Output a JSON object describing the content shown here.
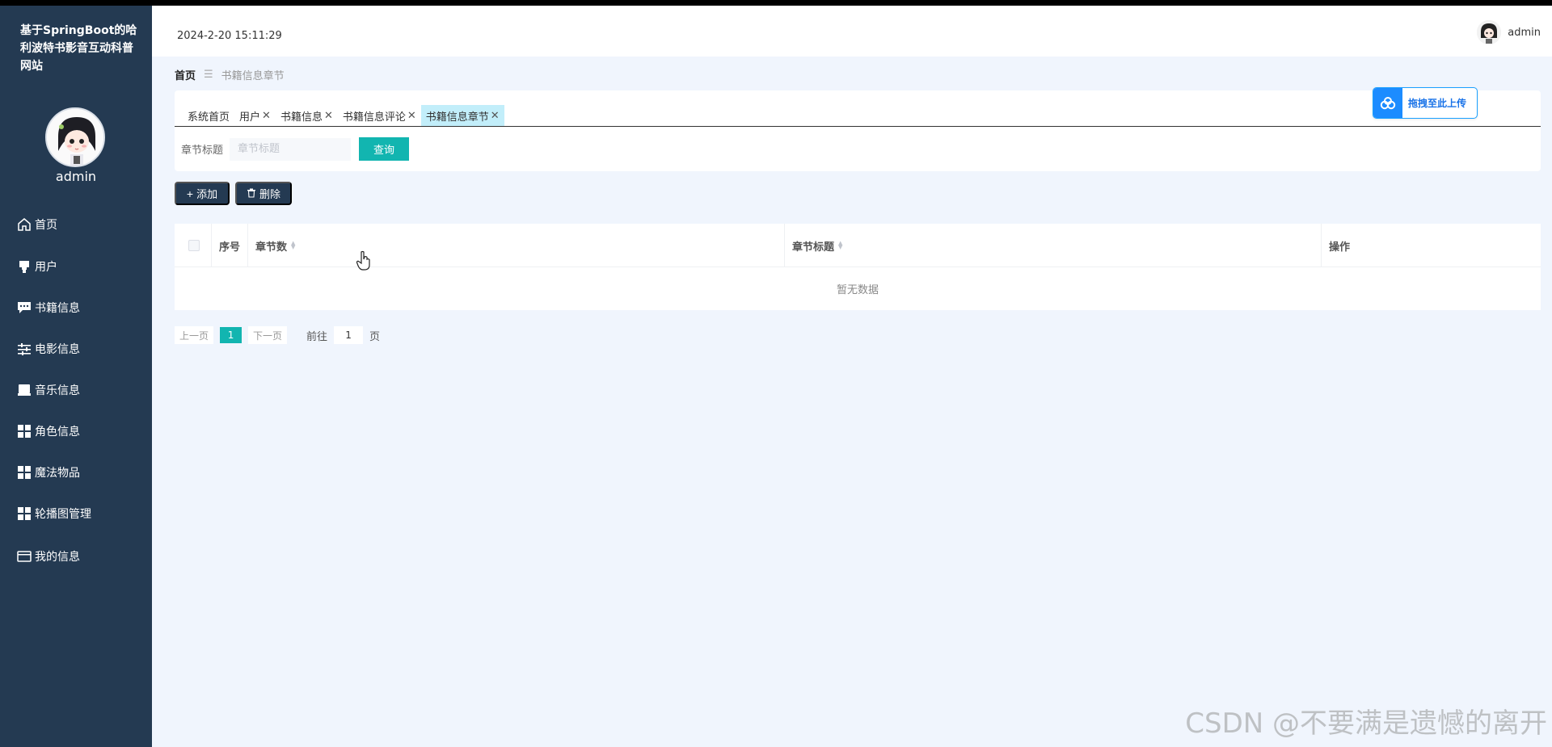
{
  "sidebar": {
    "site_title": "基于SpringBoot的哈利波特书影音互动科普网站",
    "user_name": "admin",
    "items": [
      {
        "label": "首页",
        "icon": "home-icon"
      },
      {
        "label": "用户",
        "icon": "user-icon"
      },
      {
        "label": "书籍信息",
        "icon": "chat-icon"
      },
      {
        "label": "电影信息",
        "icon": "sliders-icon"
      },
      {
        "label": "音乐信息",
        "icon": "monitor-icon"
      },
      {
        "label": "角色信息",
        "icon": "grid-icon"
      },
      {
        "label": "魔法物品",
        "icon": "grid-icon"
      },
      {
        "label": "轮播图管理",
        "icon": "grid-icon"
      },
      {
        "label": "我的信息",
        "icon": "card-icon"
      }
    ]
  },
  "header": {
    "datetime": "2024-2-20 15:11:29",
    "user_name": "admin"
  },
  "breadcrumb": {
    "home": "首页",
    "separator": "☰",
    "current": "书籍信息章节"
  },
  "tabs": [
    {
      "label": "系统首页",
      "closable": false
    },
    {
      "label": "用户",
      "closable": true
    },
    {
      "label": "书籍信息",
      "closable": true
    },
    {
      "label": "书籍信息评论",
      "closable": true
    },
    {
      "label": "书籍信息章节",
      "closable": true,
      "active": true
    }
  ],
  "search": {
    "label": "章节标题",
    "placeholder": "章节标题",
    "button": "查询"
  },
  "upload_widget": {
    "label": "拖拽至此上传"
  },
  "actions": {
    "add": "添加",
    "delete": "删除"
  },
  "table": {
    "columns": {
      "index": "序号",
      "chapter_number": "章节数",
      "chapter_title": "章节标题",
      "operation": "操作"
    },
    "empty_text": "暂无数据"
  },
  "pagination": {
    "prev": "上一页",
    "current_page": "1",
    "next": "下一页",
    "goto_label": "前往",
    "goto_value": "1",
    "goto_unit": "页"
  },
  "watermark": "CSDN @不要满是遗憾的离开",
  "colors": {
    "sidebar_bg": "#243a52",
    "accent_teal": "#12b5b0",
    "active_tab": "#c2eefa",
    "page_bg": "#f0f5fd"
  }
}
